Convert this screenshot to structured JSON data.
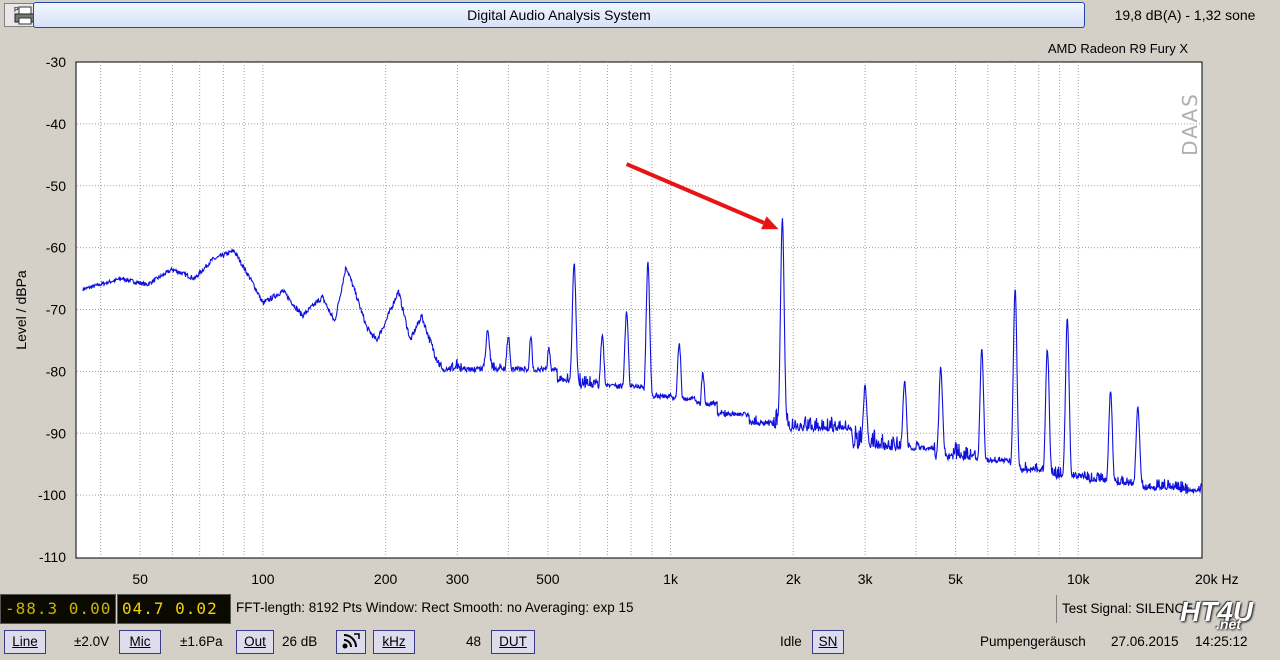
{
  "header": {
    "title": "Digital Audio Analysis System",
    "status": "19,8 dB(A) - 1,32 sone"
  },
  "device": "AMD Radeon R9 Fury X",
  "watermark": "DAAS",
  "chart_data": {
    "type": "line",
    "ylabel": "Level / dBPa",
    "xscale": "log",
    "xlim": [
      35,
      20000
    ],
    "ylim": [
      -110,
      -30
    ],
    "grid": true,
    "y_ticks": [
      -30,
      -40,
      -50,
      -60,
      -70,
      -80,
      -90,
      -100,
      -110
    ],
    "y_tick_labels": [
      "-30",
      "-40",
      "-50",
      "-60",
      "-70",
      "-80",
      "-90",
      "-100",
      "-110"
    ],
    "x_ticks": [
      50,
      100,
      200,
      300,
      500,
      1000,
      2000,
      3000,
      5000,
      10000,
      20000
    ],
    "x_tick_labels": [
      "50",
      "100",
      "200",
      "300",
      "500",
      "1k",
      "2k",
      "3k",
      "5k",
      "10k",
      "20k Hz"
    ],
    "series": [
      {
        "color": "#1010dc",
        "baseline": [
          [
            35,
            -67
          ],
          [
            45,
            -65
          ],
          [
            52,
            -66
          ],
          [
            60,
            -63.5
          ],
          [
            68,
            -65
          ],
          [
            75,
            -62
          ],
          [
            85,
            -60.5
          ],
          [
            95,
            -66
          ],
          [
            100,
            -69
          ],
          [
            112,
            -67
          ],
          [
            125,
            -71
          ],
          [
            140,
            -68
          ],
          [
            150,
            -72
          ],
          [
            160,
            -63
          ],
          [
            170,
            -68
          ],
          [
            180,
            -73
          ],
          [
            190,
            -75
          ],
          [
            200,
            -72
          ],
          [
            215,
            -67
          ],
          [
            230,
            -75
          ],
          [
            245,
            -71
          ],
          [
            260,
            -76
          ],
          [
            280,
            -81
          ],
          [
            300,
            -79
          ],
          [
            330,
            -83
          ],
          [
            350,
            -79
          ],
          [
            400,
            -81
          ],
          [
            450,
            -84
          ],
          [
            500,
            -82
          ],
          [
            600,
            -82
          ],
          [
            700,
            -84
          ],
          [
            800,
            -84
          ],
          [
            900,
            -85
          ],
          [
            1000,
            -86
          ],
          [
            1200,
            -88
          ],
          [
            1500,
            -89
          ],
          [
            1700,
            -90
          ],
          [
            1840,
            -88.5
          ],
          [
            2000,
            -90
          ],
          [
            2500,
            -90
          ],
          [
            3000,
            -92
          ],
          [
            4000,
            -94
          ],
          [
            5000,
            -94
          ],
          [
            6000,
            -96
          ],
          [
            8000,
            -97
          ],
          [
            10000,
            -98
          ],
          [
            14000,
            -99
          ],
          [
            20000,
            -100
          ]
        ],
        "noise": [
          [
            35,
            0.3
          ],
          [
            250,
            0.5
          ],
          [
            300,
            1.5
          ],
          [
            600,
            2
          ],
          [
            1500,
            2.5
          ],
          [
            3000,
            3
          ],
          [
            6000,
            2.5
          ],
          [
            10000,
            2
          ],
          [
            20000,
            2
          ]
        ],
        "peaks": [
          [
            356,
            -73
          ],
          [
            400,
            -74
          ],
          [
            454,
            -74
          ],
          [
            503,
            -76
          ],
          [
            580,
            -62
          ],
          [
            680,
            -74
          ],
          [
            780,
            -70
          ],
          [
            880,
            -62
          ],
          [
            1050,
            -75
          ],
          [
            1200,
            -80
          ],
          [
            1880,
            -55
          ],
          [
            3000,
            -82
          ],
          [
            3750,
            -81
          ],
          [
            4600,
            -79
          ],
          [
            5800,
            -76
          ],
          [
            7000,
            -66
          ],
          [
            8400,
            -76
          ],
          [
            9400,
            -71
          ],
          [
            12000,
            -83
          ],
          [
            14000,
            -85
          ]
        ]
      }
    ],
    "annotation": {
      "type": "arrow",
      "color": "#e81414",
      "from": [
        780,
        -46.5
      ],
      "to": [
        1840,
        -57
      ]
    }
  },
  "footer": {
    "meter1": "-88.3 0.00",
    "meter2": "04.7 0.02",
    "fft_info": "FFT-length: 8192 Pts   Window: Rect  Smooth: no  Averaging: exp 15",
    "test_signal": "Test Signal: SILENCE",
    "btn_line": "Line",
    "line_value": "±2.0V",
    "btn_mic": "Mic",
    "mic_value": "±1.6Pa",
    "btn_out": "Out",
    "out_value": "26 dB",
    "btn_khz": "kHz",
    "khz_value": "48",
    "btn_dut": "DUT",
    "state": "Idle",
    "btn_sn": "SN",
    "device_name": "Pumpengeräusch",
    "date": "27.06.2015",
    "time": "14:25:12"
  },
  "logo": {
    "main": "HT4U",
    "sub": ".net"
  }
}
